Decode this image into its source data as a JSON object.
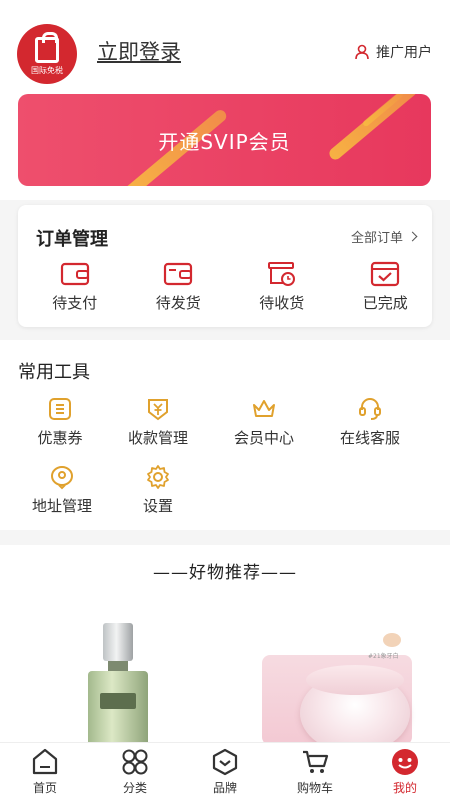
{
  "header": {
    "logo_text": "国际免税",
    "login_label": "立即登录",
    "promote_label": "推广用户"
  },
  "banner": {
    "label": "开通SVIP会员"
  },
  "orders": {
    "title": "订单管理",
    "all_label": "全部订单",
    "items": [
      {
        "label": "待支付",
        "icon": "wallet-icon"
      },
      {
        "label": "待发货",
        "icon": "wallet-send-icon"
      },
      {
        "label": "待收货",
        "icon": "truck-clock-icon"
      },
      {
        "label": "已完成",
        "icon": "check-box-icon"
      }
    ]
  },
  "tools": {
    "title": "常用工具",
    "items": [
      {
        "label": "优惠券",
        "icon": "coupon-icon"
      },
      {
        "label": "收款管理",
        "icon": "yen-icon"
      },
      {
        "label": "会员中心",
        "icon": "crown-icon"
      },
      {
        "label": "在线客服",
        "icon": "headset-icon"
      },
      {
        "label": "地址管理",
        "icon": "location-pin-icon"
      },
      {
        "label": "设置",
        "icon": "gear-icon"
      }
    ]
  },
  "recommend": {
    "title": "——好物推荐——",
    "shade_label": "#21象牙白"
  },
  "tabbar": {
    "items": [
      {
        "label": "首页",
        "icon": "home-icon"
      },
      {
        "label": "分类",
        "icon": "grid-icon"
      },
      {
        "label": "品牌",
        "icon": "brand-icon"
      },
      {
        "label": "购物车",
        "icon": "cart-icon"
      },
      {
        "label": "我的",
        "icon": "profile-icon"
      }
    ],
    "active_index": 4
  },
  "colors": {
    "accent": "#d3282f",
    "icon_red": "#d3282f",
    "icon_gold": "#e0a12d",
    "banner": "#e7385d"
  }
}
